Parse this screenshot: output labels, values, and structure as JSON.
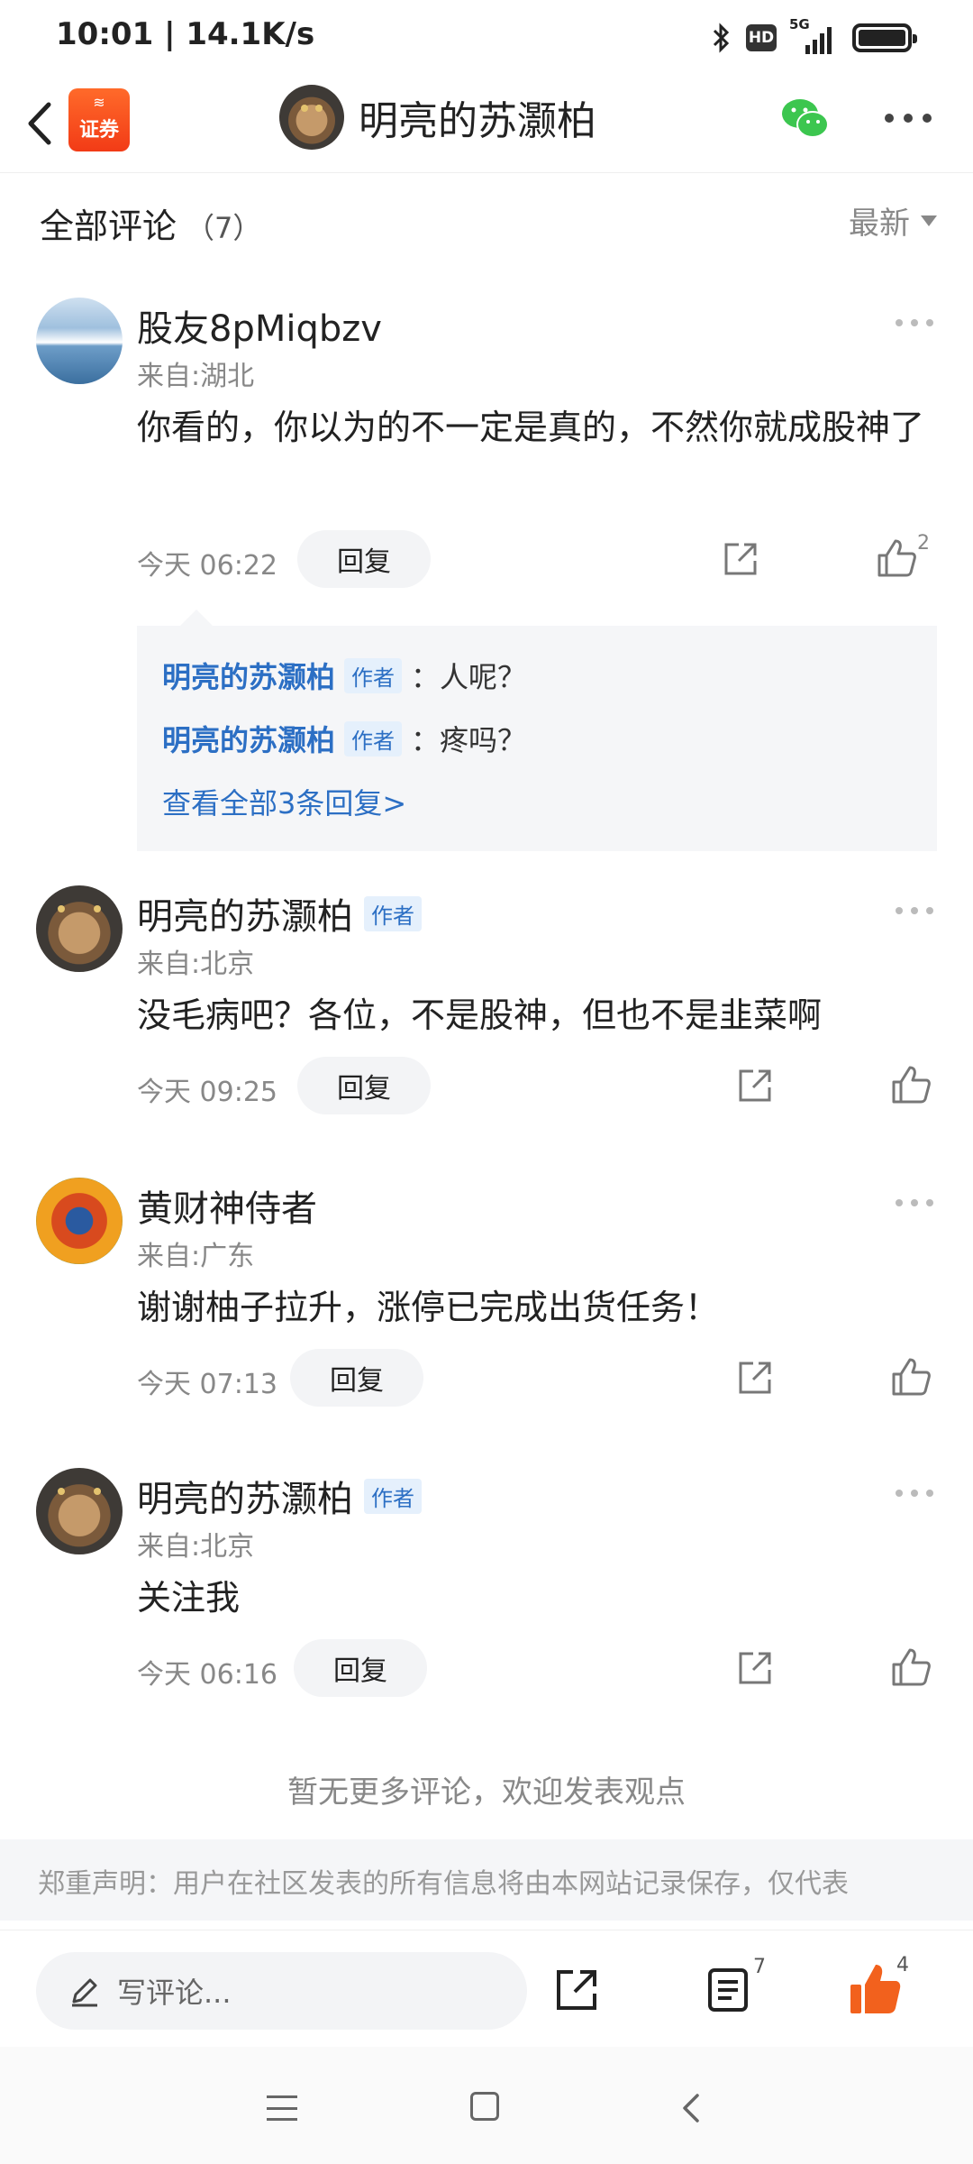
{
  "status_bar": {
    "time_speed": "10:01 | 14.1K/s",
    "hd": "HD",
    "network": "5G"
  },
  "header": {
    "app_logo_text": "证券",
    "title": "明亮的苏灏柏"
  },
  "section": {
    "title": "全部评论",
    "count": "（7）",
    "sort_label": "最新"
  },
  "author_tag": "作者",
  "reply_label": "回复",
  "comments": [
    {
      "name": "股友8pMiqbzv",
      "location": "来自:湖北",
      "text": "你看的，你以为的不一定是真的，不然你就成股神了",
      "time": "今天 06:22",
      "likes": "2",
      "replies": [
        {
          "name": "明亮的苏灏柏",
          "text": "：人呢？"
        },
        {
          "name": "明亮的苏灏柏",
          "text": "：疼吗？"
        }
      ],
      "view_all": "查看全部3条回复>"
    },
    {
      "name": "明亮的苏灏柏",
      "location": "来自:北京",
      "text": "没毛病吧？各位，不是股神，但也不是韭菜啊",
      "time": "今天 09:25"
    },
    {
      "name": "黄财神侍者",
      "location": "来自:广东",
      "text": "谢谢柚子拉升，涨停已完成出货任务！",
      "time": "今天 07:13"
    },
    {
      "name": "明亮的苏灏柏",
      "location": "来自:北京",
      "text": "关注我",
      "time": "今天 06:16"
    }
  ],
  "no_more": "暂无更多评论，欢迎发表观点",
  "disclaimer": "郑重声明：用户在社区发表的所有信息将由本网站记录保存，仅代表",
  "bottom_bar": {
    "placeholder": "写评论...",
    "comment_count": "7",
    "like_count": "4"
  },
  "colors": {
    "accent_blue": "#2c6fc4",
    "like_orange": "#f2611d",
    "wechat_green": "#3cc64f"
  }
}
